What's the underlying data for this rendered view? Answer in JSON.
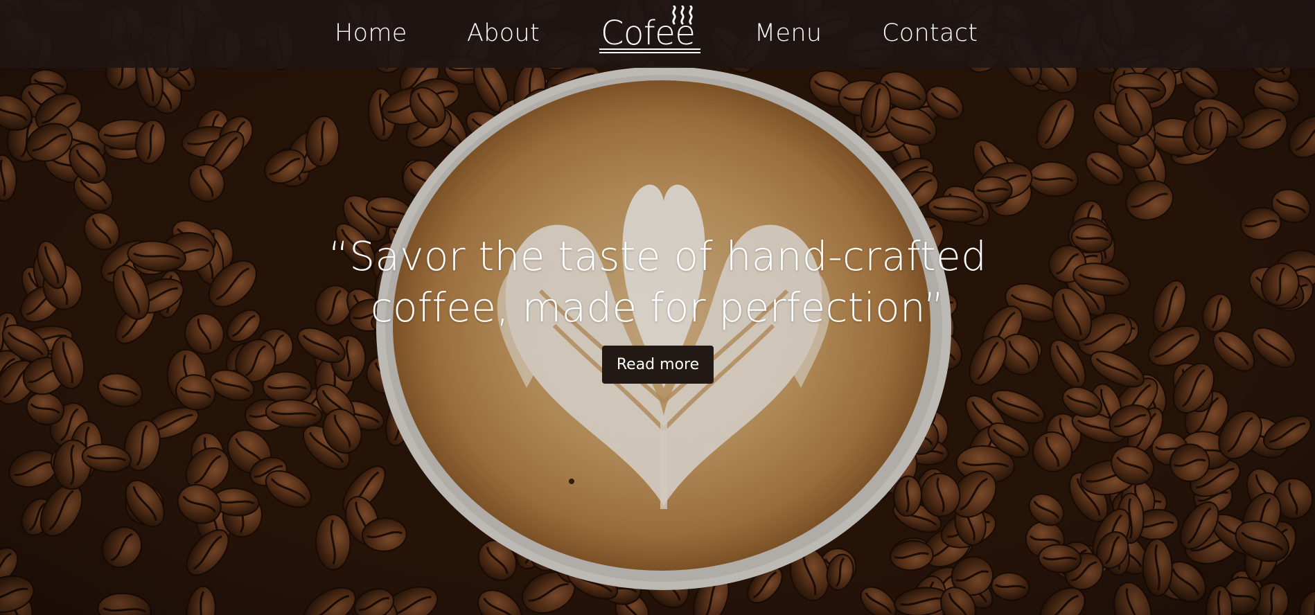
{
  "nav": {
    "home": "Home",
    "about": "About",
    "logo_text": "Cofee",
    "menu": "Menu",
    "contact": "Contact"
  },
  "hero": {
    "quote_line1": "“Savor the taste of hand-crafted",
    "quote_line2": "coffee, made for perfection”",
    "button_label": "Read more"
  },
  "colors": {
    "navbar": "#1e1614",
    "button": "#221814",
    "text": "#ffffff",
    "coffee_crema": "#c49a62"
  },
  "icons": {
    "logo_icon": "steam-icon",
    "background": "coffee-beans-with-latte-art-cup"
  }
}
